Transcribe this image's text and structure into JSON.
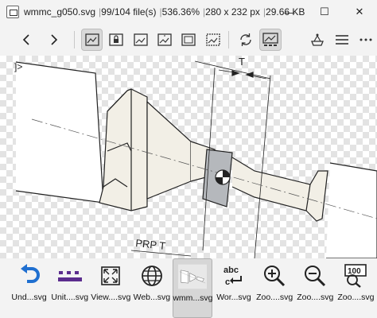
{
  "titlebar": {
    "filename": "wmmc_g050.svg",
    "file_index": "99/104 file(s)",
    "zoom": "536.36%",
    "dimensions": "280 x 232 px",
    "filesize": "29.66 KB",
    "minimize": "—",
    "maximize": "☐",
    "close": "✕"
  },
  "drawing": {
    "label_t": "T",
    "label_prp": "PRP T",
    "label_bracket": "]>"
  },
  "thumbnails": [
    {
      "label": "Und...svg",
      "icon": "undo-icon"
    },
    {
      "label": "Unit....svg",
      "icon": "units-icon"
    },
    {
      "label": "View....svg",
      "icon": "view-icon"
    },
    {
      "label": "Web...svg",
      "icon": "web-icon"
    },
    {
      "label": "wmm...svg",
      "icon": "drawing-thumbnail"
    },
    {
      "label": "Wor...svg",
      "icon": "word-wrap-icon"
    },
    {
      "label": "Zoo....svg",
      "icon": "zoom-in-icon"
    },
    {
      "label": "Zoo....svg",
      "icon": "zoom-out-icon"
    },
    {
      "label": "Zoo....svg",
      "icon": "zoom-100-icon"
    }
  ],
  "colors": {
    "accent_blue": "#1f6fd0",
    "purple": "#5b2d8e"
  }
}
